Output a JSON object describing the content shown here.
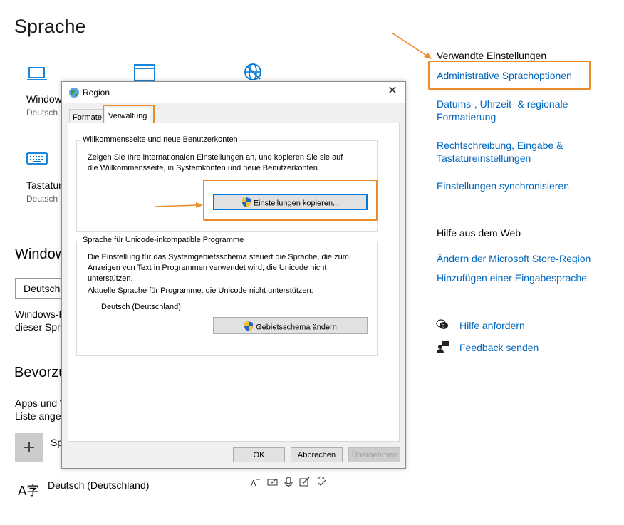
{
  "page": {
    "title": "Sprache"
  },
  "tiles": [
    {
      "label": "Windows",
      "sub": "Deutsch (",
      "icon": "laptop-icon"
    },
    {
      "icon": "window-icon"
    },
    {
      "icon": "globe-speech-icon"
    },
    {
      "label": "Tastatur",
      "sub": "Deutsch (",
      "icon": "keyboard-icon"
    }
  ],
  "windows_display": {
    "heading": "Window",
    "combo_value": "Deutsch",
    "desc_line1": "Windows-F",
    "desc_line2": "dieser Spra"
  },
  "preferred": {
    "heading": "Bevorzu",
    "desc_line1": "Apps und W",
    "desc_line2": "Liste angez",
    "add_label": "Sp",
    "language_item": "Deutsch (Deutschland)",
    "language_glyph": "A字",
    "feature_icons": [
      "text-to-speech-icon",
      "handwriting-icon",
      "microphone-icon",
      "pen-icon",
      "spellcheck-icon"
    ]
  },
  "sidebar": {
    "related_heading": "Verwandte Einstellungen",
    "related_links": [
      {
        "label": "Administrative Sprachoptionen"
      },
      {
        "label_line1": "Datums-, Uhrzeit- & regionale",
        "label_line2": "Formatierung"
      },
      {
        "label_line1": "Rechtschreibung, Eingabe &",
        "label_line2": "Tastatureinstellungen"
      },
      {
        "label": "Einstellungen synchronisieren"
      }
    ],
    "web_help_heading": "Hilfe aus dem Web",
    "web_links": [
      "Ändern der Microsoft Store-Region",
      "Hinzufügen einer Eingabesprache"
    ],
    "help_links": [
      {
        "label": "Hilfe anfordern",
        "icon": "help-chat-icon"
      },
      {
        "label": "Feedback senden",
        "icon": "feedback-icon"
      }
    ]
  },
  "dialog": {
    "title": "Region",
    "close_glyph": "✕",
    "tabs": [
      "Formate",
      "Verwaltung"
    ],
    "active_tab": "Verwaltung",
    "group1": {
      "title": "Willkommensseite und neue Benutzerkonten",
      "text_line1": "Zeigen Sie Ihre internationalen Einstellungen an, und kopieren Sie sie auf",
      "text_line2": "die Willkommensseite, in Systemkonten und neue Benutzerkonten.",
      "button": "Einstellungen kopieren..."
    },
    "group2": {
      "title": "Sprache für Unicode-inkompatible Programme",
      "text_line1": "Die Einstellung für das Systemgebietsschema steuert die Sprache, die zum",
      "text_line2": "Anzeigen von Text in Programmen verwendet wird, die Unicode nicht",
      "text_line3": "unterstützen.",
      "text_line4": "Aktuelle Sprache für Programme, die Unicode nicht unterstützen:",
      "current_language": "Deutsch (Deutschland)",
      "button": "Gebietsschema ändern"
    },
    "buttons": {
      "ok": "OK",
      "cancel": "Abbrechen",
      "apply": "Übernehmen"
    }
  },
  "colors": {
    "accent_link": "#0067c0",
    "highlight_orange": "#ec8a2c",
    "icon_blue": "#0078d7"
  }
}
